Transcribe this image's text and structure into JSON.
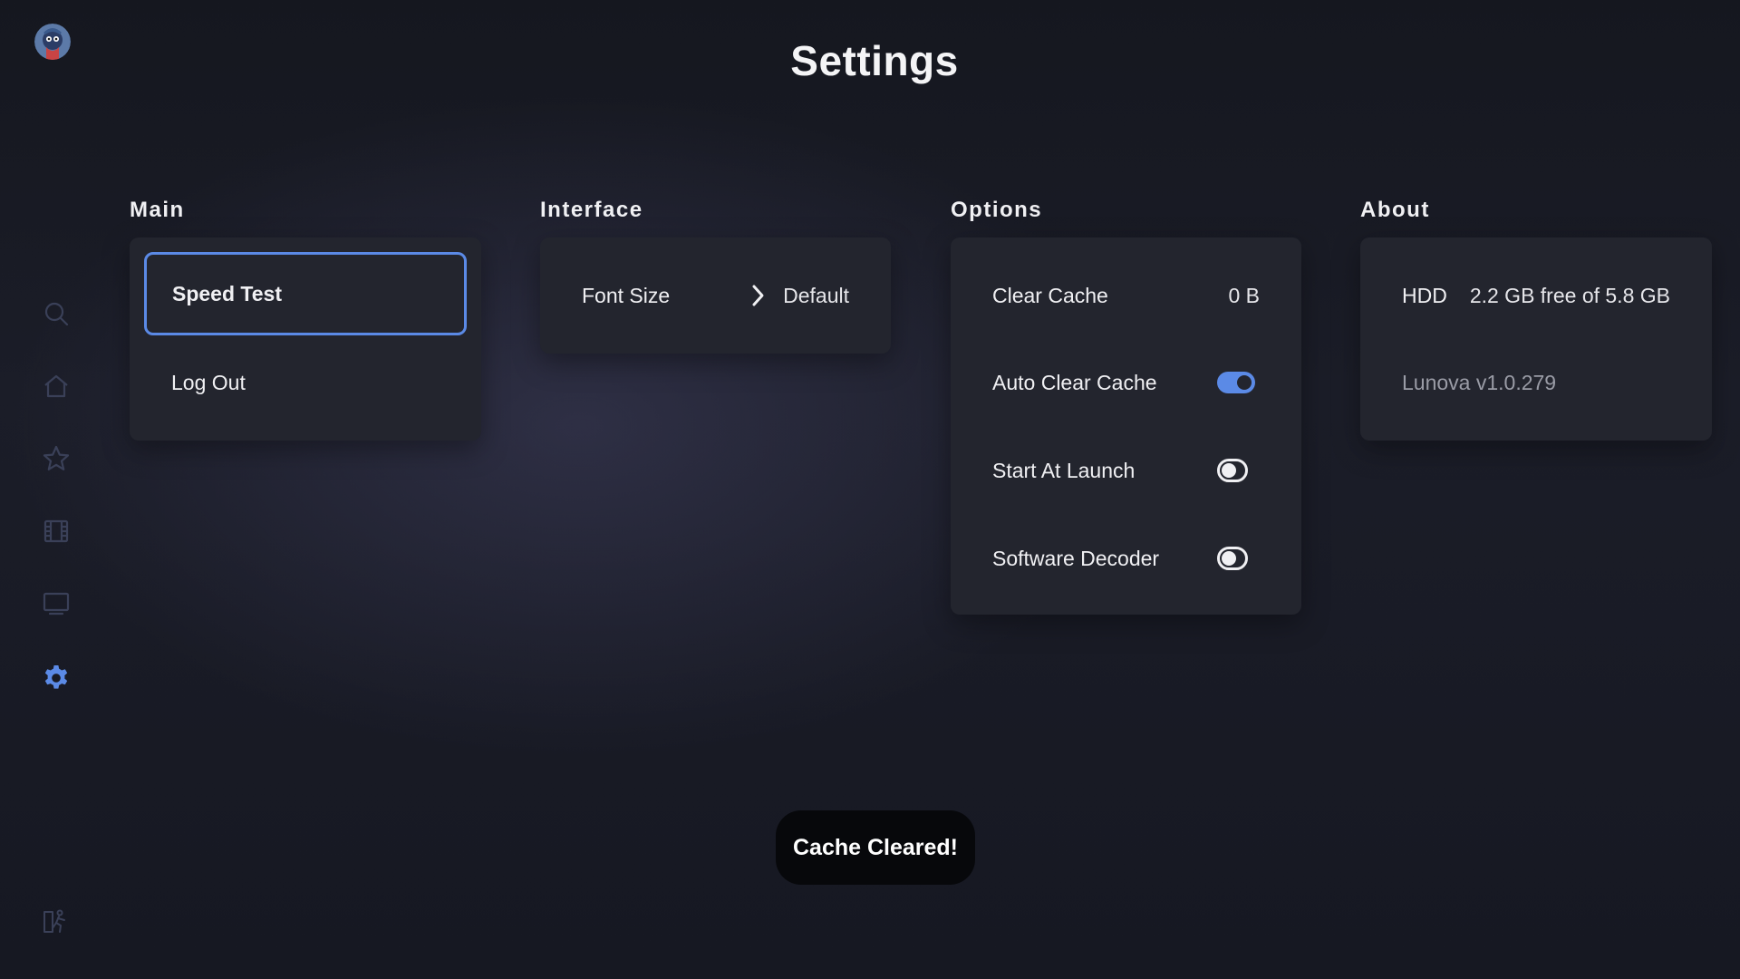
{
  "page": {
    "title": "Settings"
  },
  "sidebar": {
    "icons": [
      {
        "name": "search-icon"
      },
      {
        "name": "home-icon"
      },
      {
        "name": "star-icon"
      },
      {
        "name": "film-icon"
      },
      {
        "name": "tv-icon"
      },
      {
        "name": "gear-icon",
        "active": true
      },
      {
        "name": "exit-icon"
      }
    ],
    "active_color": "#5b8ae6",
    "inactive_color": "#3a4058"
  },
  "sections": {
    "main": {
      "title": "Main",
      "items": [
        {
          "label": "Speed Test",
          "focused": true
        },
        {
          "label": "Log Out"
        }
      ]
    },
    "interface": {
      "title": "Interface",
      "items": [
        {
          "label": "Font Size",
          "value": "Default",
          "icon": "chevron-right-icon"
        }
      ]
    },
    "options": {
      "title": "Options",
      "items": [
        {
          "label": "Clear Cache",
          "value": "0 B"
        },
        {
          "label": "Auto Clear Cache",
          "toggle": "on"
        },
        {
          "label": "Start At Launch",
          "toggle": "off"
        },
        {
          "label": "Software Decoder",
          "toggle": "off"
        }
      ]
    },
    "about": {
      "title": "About",
      "items": [
        {
          "label": "HDD",
          "value": "2.2 GB free of 5.8 GB"
        },
        {
          "label": "Lunova v1.0.279"
        }
      ]
    }
  },
  "toast": {
    "message": "Cache Cleared!"
  },
  "colors": {
    "accent": "#5b8ae6",
    "card": "#23252e",
    "toast": "#07080b"
  }
}
